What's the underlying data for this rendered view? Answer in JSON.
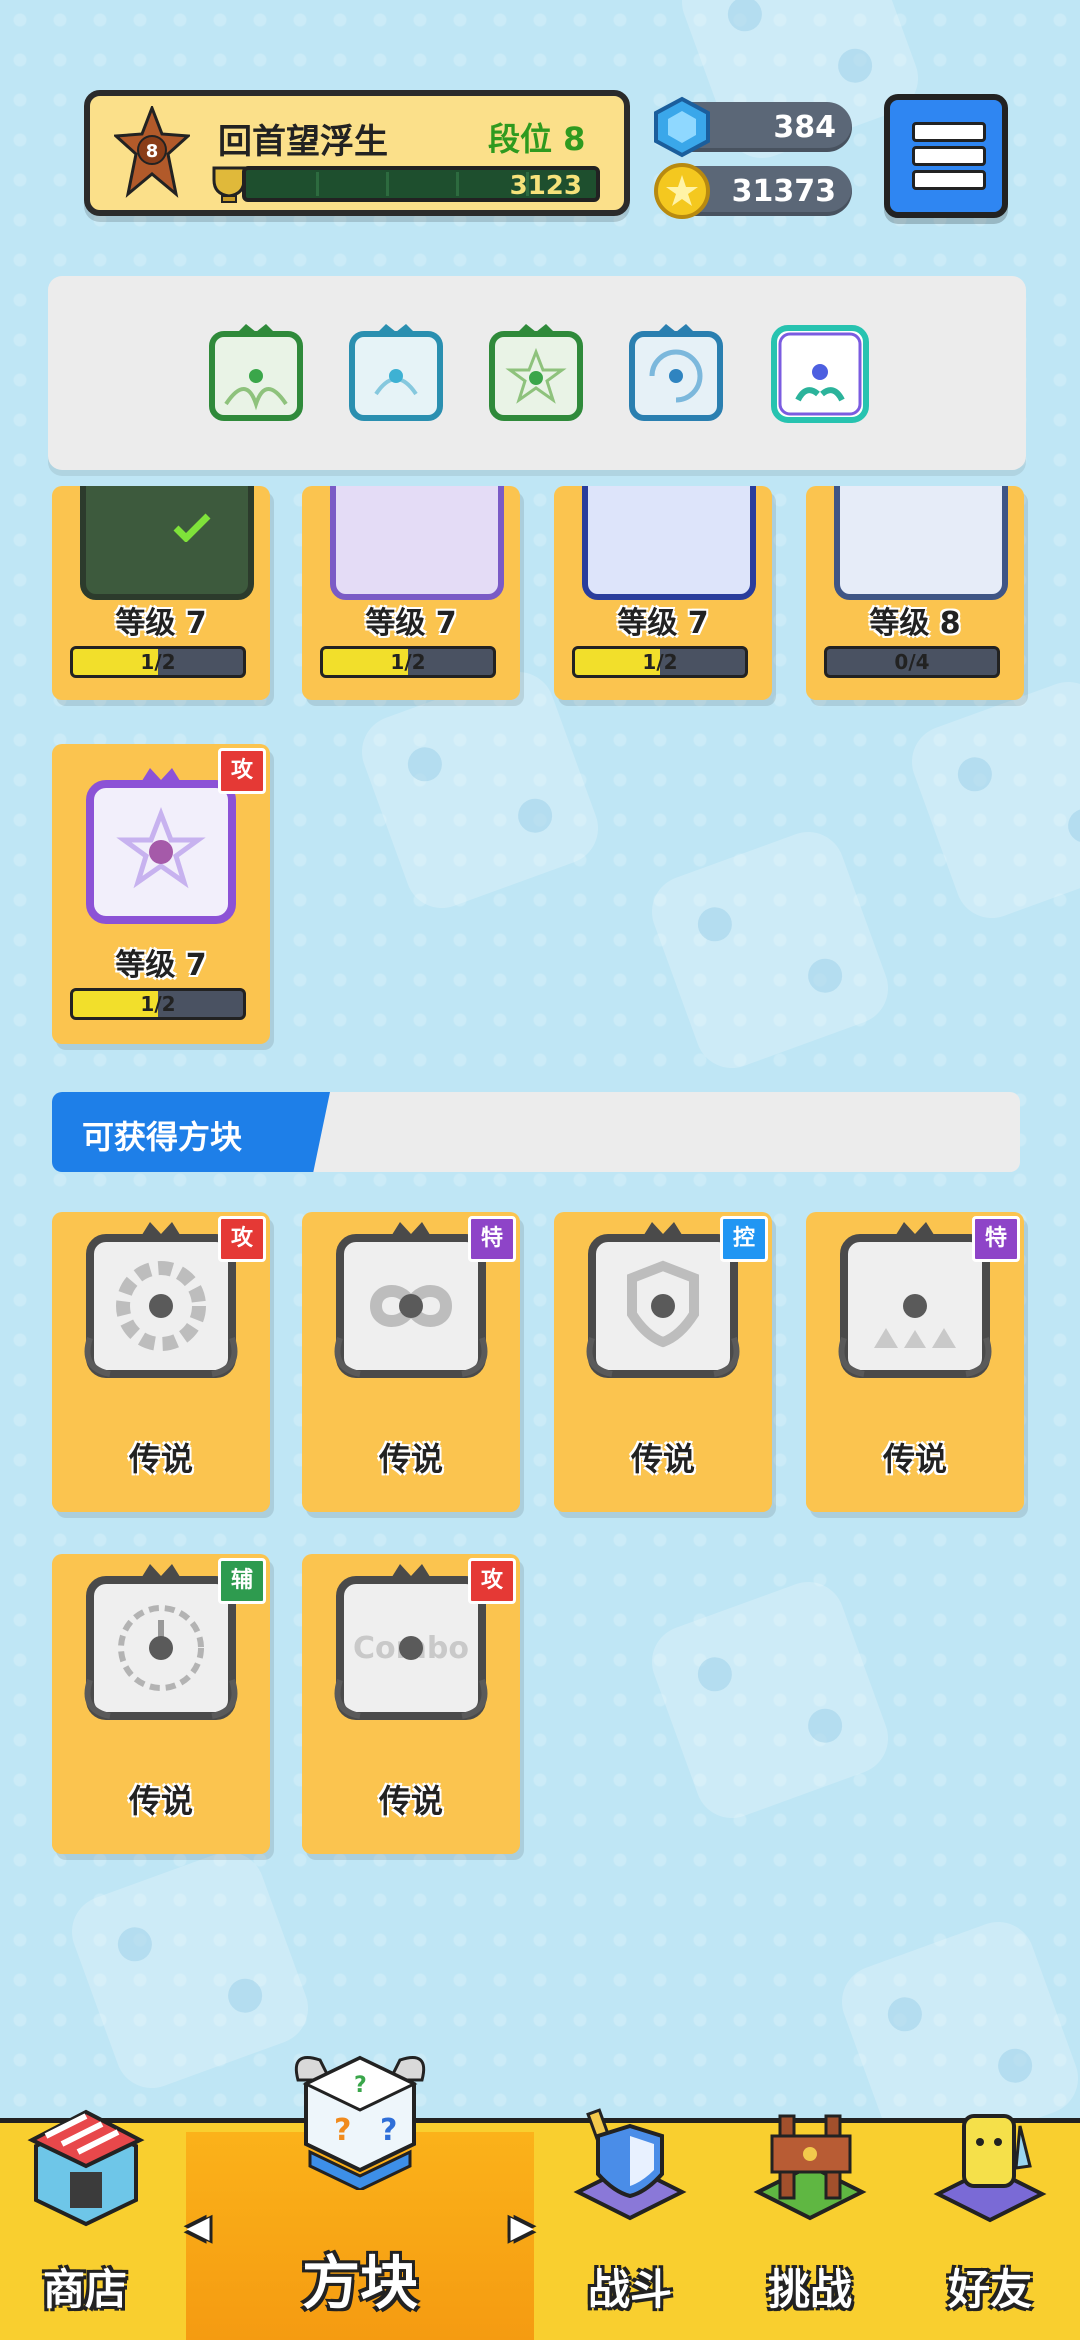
{
  "header": {
    "player_name": "回首望浮生",
    "rank_label": "段位 8",
    "rank_badge": "8",
    "xp_value": "3123",
    "gems": "384",
    "coins": "31373"
  },
  "deck": {
    "slots": [
      "green-dragon-die",
      "cyan-dragon-die",
      "green-star-die",
      "blue-swirl-die",
      "hand-orb-die"
    ]
  },
  "owned_cards": [
    {
      "level": "等级 7",
      "progress": "1/2",
      "fill": 0.5,
      "color": "#3a5a3a",
      "checked": true
    },
    {
      "level": "等级 7",
      "progress": "1/2",
      "fill": 0.5,
      "color": "#a99ad6"
    },
    {
      "level": "等级 7",
      "progress": "1/2",
      "fill": 0.5,
      "color": "#8fa2e0"
    },
    {
      "level": "等级 8",
      "progress": "0/4",
      "fill": 0.0,
      "color": "#c9d6f0"
    },
    {
      "level": "等级 7",
      "progress": "1/2",
      "fill": 0.5,
      "color": "#c7b9f2",
      "badge": "攻",
      "badge_color": "#e53935"
    }
  ],
  "available": {
    "title": "可获得方块",
    "cards": [
      {
        "rarity": "传说",
        "badge": "攻",
        "badge_color": "#e53935",
        "symbol": "gear"
      },
      {
        "rarity": "传说",
        "badge": "特",
        "badge_color": "#8e44c8",
        "symbol": "infinity"
      },
      {
        "rarity": "传说",
        "badge": "控",
        "badge_color": "#2196f3",
        "symbol": "shield"
      },
      {
        "rarity": "传说",
        "badge": "特",
        "badge_color": "#8e44c8",
        "symbol": "arrows"
      },
      {
        "rarity": "传说",
        "badge": "辅",
        "badge_color": "#2e9b4f",
        "symbol": "clock"
      },
      {
        "rarity": "传说",
        "badge": "攻",
        "badge_color": "#e53935",
        "symbol": "combo"
      }
    ]
  },
  "nav": {
    "shop": "商店",
    "dice": "方块",
    "battle": "战斗",
    "challenge": "挑战",
    "friends": "好友",
    "left_arrow": "◀",
    "right_arrow": "▶"
  }
}
